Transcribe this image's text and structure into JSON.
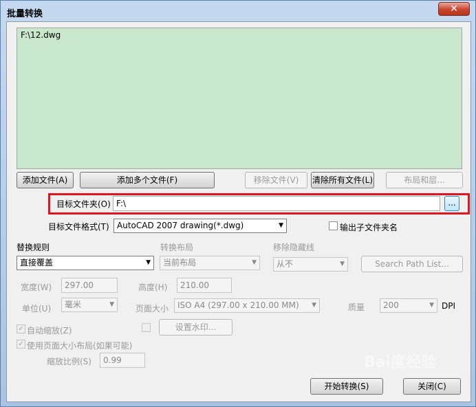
{
  "window": {
    "title": "批量转换",
    "close_glyph": "✕"
  },
  "file_list": {
    "items": [
      "F:\\12.dwg"
    ]
  },
  "buttons": {
    "add_file": "添加文件(A)",
    "add_multiple": "添加多个文件(F)",
    "remove_file": "移除文件(V)",
    "clear_all": "清除所有文件(L)",
    "layout_layers": "布局和层...",
    "browse": "...",
    "search_path": "Search Path List...",
    "watermark": "设置水印...",
    "start": "开始转换(S)",
    "close": "关闭(C)"
  },
  "target_folder": {
    "label": "目标文件夹(O)",
    "value": "F:\\"
  },
  "target_format": {
    "label": "目标文件格式(T)",
    "value": "AutoCAD 2007 drawing(*.dwg)"
  },
  "output_subfolder": {
    "label": "输出子文件夹名",
    "checked": false
  },
  "replace_rule": {
    "label": "替换规则",
    "value": "直接覆盖"
  },
  "convert_layout": {
    "label": "转换布局",
    "value": "当前布局"
  },
  "remove_hidden": {
    "label": "移除隐藏线",
    "value": "从不"
  },
  "width": {
    "label": "宽度(W)",
    "value": "297.00"
  },
  "height": {
    "label": "高度(H)",
    "value": "210.00"
  },
  "unit": {
    "label": "单位(U)",
    "value": "毫米"
  },
  "page_size": {
    "label": "页面大小",
    "value": "ISO A4 (297.00 x 210.00 MM)"
  },
  "quality": {
    "label": "质量",
    "value": "200",
    "unit": "DPI"
  },
  "auto_zoom": {
    "label": "自动缩放(Z)",
    "checked": true
  },
  "use_page_size": {
    "label": "使用页面大小布局(如果可能)",
    "checked": true
  },
  "zoom_ratio": {
    "label": "缩放比例(S)",
    "value": "0.99"
  },
  "watermark_text": "Bai度经验"
}
